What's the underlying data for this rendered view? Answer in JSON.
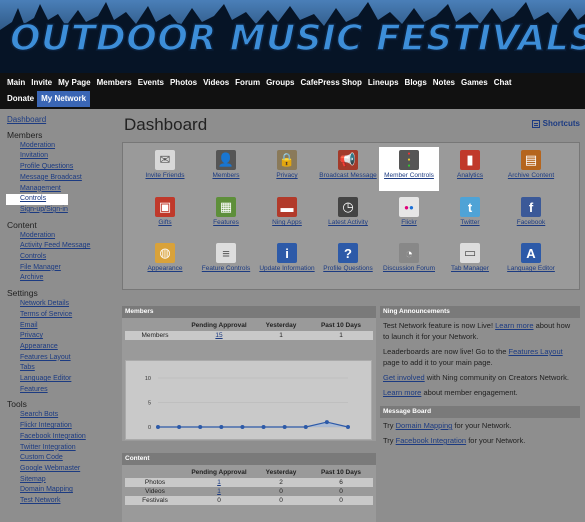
{
  "banner": {
    "title": "OUTDOOR MUSIC FESTIVALS"
  },
  "nav": {
    "row1": [
      "Main",
      "Invite",
      "My Page",
      "Members",
      "Events",
      "Photos",
      "Videos",
      "Forum",
      "Groups",
      "CafePress Shop",
      "Lineups",
      "Blogs",
      "Notes",
      "Games",
      "Chat"
    ],
    "row2": [
      "Donate",
      "My Network"
    ],
    "active": "My Network"
  },
  "sidebar": {
    "dashboard": "Dashboard",
    "sections": [
      {
        "title": "Members",
        "items": [
          "Moderation",
          "Invitation",
          "Profile Questions",
          "Message Broadcast",
          "Management",
          "Controls",
          "Sign-up/Sign-in"
        ]
      },
      {
        "title": "Content",
        "items": [
          "Moderation",
          "Activity Feed Message",
          "Controls",
          "File Manager",
          "Archive"
        ]
      },
      {
        "title": "Settings",
        "items": [
          "Network Details",
          "Terms of Service",
          "Email",
          "Privacy",
          "Appearance",
          "Features Layout",
          "Tabs",
          "Language Editor",
          "Features"
        ]
      },
      {
        "title": "Tools",
        "items": [
          "Search Bots",
          "Flickr Integration",
          "Facebook Integration",
          "Twitter Integration",
          "Custom Code",
          "Google Webmaster",
          "Sitemap",
          "Domain Mapping",
          "Test Network"
        ]
      }
    ]
  },
  "main": {
    "title": "Dashboard",
    "shortcuts": "Shortcuts",
    "icons": [
      {
        "label": "Invite Friends",
        "icon": "envelope-icon",
        "color": "#d8d8d8"
      },
      {
        "label": "Members",
        "icon": "people-icon",
        "color": "#555555"
      },
      {
        "label": "Privacy",
        "icon": "lock-icon",
        "color": "#8a7a5a"
      },
      {
        "label": "Broadcast Message",
        "icon": "megaphone-icon",
        "color": "#a33a2a"
      },
      {
        "label": "Member Controls",
        "icon": "traffic-light-icon",
        "color": "#555555"
      },
      {
        "label": "Analytics",
        "icon": "bar-chart-icon",
        "color": "#c0392b"
      },
      {
        "label": "Archive Content",
        "icon": "archive-icon",
        "color": "#b5651d"
      },
      {
        "label": "Gifts",
        "icon": "gift-icon",
        "color": "#c0392b"
      },
      {
        "label": "Features",
        "icon": "grid-icon",
        "color": "#5e8f3a"
      },
      {
        "label": "Ning Apps",
        "icon": "toolbox-icon",
        "color": "#b23a2a"
      },
      {
        "label": "Latest Activity",
        "icon": "clock-icon",
        "color": "#444444"
      },
      {
        "label": "Flickr",
        "icon": "flickr-icon",
        "color": "#e6e6e6"
      },
      {
        "label": "Twitter",
        "icon": "twitter-icon",
        "color": "#4fa3d6"
      },
      {
        "label": "Facebook",
        "icon": "facebook-icon",
        "color": "#3b5998"
      },
      {
        "label": "Appearance",
        "icon": "color-wheel-icon",
        "color": "#d9a23a"
      },
      {
        "label": "Feature Controls",
        "icon": "sliders-icon",
        "color": "#dddddd"
      },
      {
        "label": "Update Information",
        "icon": "info-icon",
        "color": "#2d5aa8"
      },
      {
        "label": "Profile Questions",
        "icon": "question-icon",
        "color": "#2d5aa8"
      },
      {
        "label": "Discussion Forum",
        "icon": "speech-bubble-icon",
        "color": "#888888"
      },
      {
        "label": "Tab Manager",
        "icon": "tabs-icon",
        "color": "#dddddd"
      },
      {
        "label": "Language Editor",
        "icon": "letter-a-icon",
        "color": "#2d5aa8"
      }
    ],
    "selected_icon": "Member Controls"
  },
  "members_box": {
    "title": "Members",
    "headers": [
      "",
      "Pending Approval",
      "Yesterday",
      "Past 10 Days"
    ],
    "row": [
      "Members",
      "15",
      "1",
      "1"
    ]
  },
  "chart_data": {
    "type": "line",
    "series": [
      {
        "values": [
          0,
          0,
          0,
          0,
          0,
          0,
          0,
          0,
          1,
          0
        ]
      }
    ],
    "yticks": [
      "10",
      "5",
      "0"
    ],
    "ylim": [
      0,
      10
    ]
  },
  "content_box": {
    "title": "Content",
    "headers": [
      "",
      "Pending Approval",
      "Yesterday",
      "Past 10 Days"
    ],
    "rows": [
      [
        "Photos",
        "1",
        "2",
        "6"
      ],
      [
        "Videos",
        "1",
        "0",
        "0"
      ],
      [
        "Festivals",
        "0",
        "0",
        "0"
      ]
    ]
  },
  "announcements": {
    "title": "Ning Announcements",
    "items": [
      {
        "pre": "Test Network feature is now Live! ",
        "link": "Learn more",
        "post": " about how to launch it for your Network."
      },
      {
        "pre": "Leaderboards are now live! Go to the ",
        "link": "Features Layout",
        "post": " page to add it to your main page."
      },
      {
        "pre": "",
        "link": "Get involved",
        "post": " with Ning community on Creators Network."
      },
      {
        "pre": "",
        "link": "Learn more",
        "post": " about member engagement."
      }
    ]
  },
  "message_board": {
    "title": "Message Board",
    "items": [
      {
        "pre": "Try ",
        "link": "Domain Mapping",
        "post": " for your Network."
      },
      {
        "pre": "Try ",
        "link": "Facebook Integration",
        "post": " for your Network."
      }
    ]
  }
}
